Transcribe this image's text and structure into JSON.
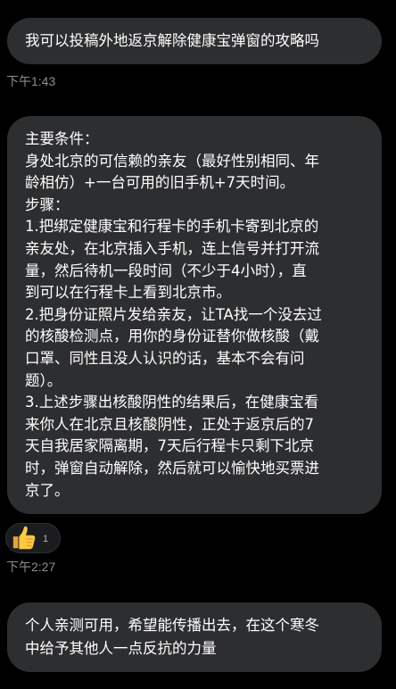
{
  "messages": [
    {
      "text": "我可以投稿外地返京解除健康宝弹窗的攻略吗",
      "time": "下午1:43"
    },
    {
      "lines": [
        "主要条件：",
        "身处北京的可信赖的亲友（最好性别相同、年",
        "龄相仿）+一台可用的旧手机+7天时间。",
        "步骤：",
        "1.把绑定健康宝和行程卡的手机卡寄到北京的",
        "亲友处，在北京插入手机，连上信号并打开流",
        "量，然后待机一段时间（不少于4小时），直",
        "到可以在行程卡上看到北京市。",
        "2.把身份证照片发给亲友，让TA找一个没去过",
        "的核酸检测点，用你的身份证替你做核酸（戴",
        "口罩、同性且没人认识的话，基本不会有问",
        "题）。",
        "3.上述步骤出核酸阴性的结果后，在健康宝看",
        "来你人在北京且核酸阴性，正处于返京后的7",
        "天自我居家隔离期，7天后行程卡只剩下北京",
        "时，弹窗自动解除，然后就可以愉快地买票进",
        "京了。"
      ],
      "reaction": {
        "icon": "thumbs-up-icon",
        "count": "1"
      },
      "time": "下午2:27"
    },
    {
      "lines": [
        "个人亲测可用，希望能传播出去，在这个寒冬",
        "中给予其他人一点反抗的力量"
      ]
    }
  ],
  "colors": {
    "background": "#000000",
    "bubble": "#2d2e30",
    "text": "#ffffff",
    "timestamp": "#8a8d91",
    "reaction_background": "#1b1c1e"
  }
}
